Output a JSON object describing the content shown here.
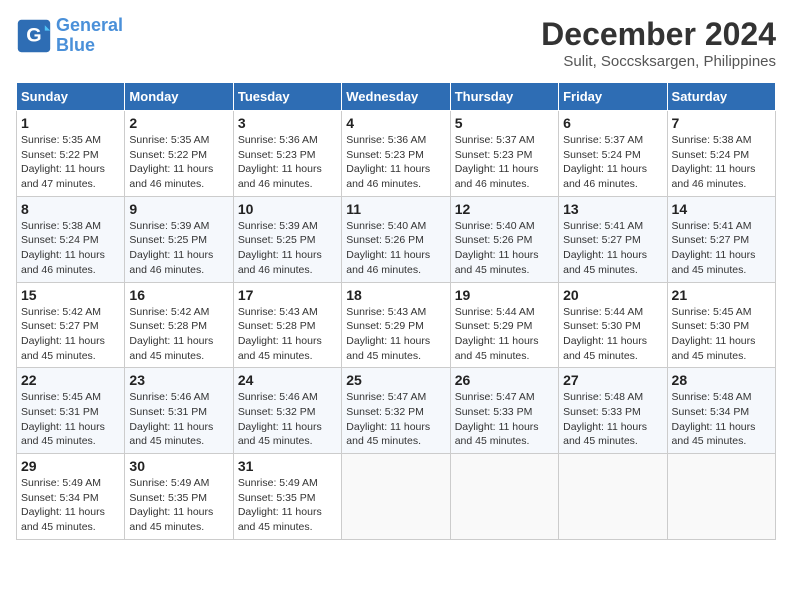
{
  "logo": {
    "line1": "General",
    "line2": "Blue"
  },
  "title": "December 2024",
  "subtitle": "Sulit, Soccsksargen, Philippines",
  "days_of_week": [
    "Sunday",
    "Monday",
    "Tuesday",
    "Wednesday",
    "Thursday",
    "Friday",
    "Saturday"
  ],
  "weeks": [
    [
      {
        "day": 1,
        "sunrise": "5:35 AM",
        "sunset": "5:22 PM",
        "daylight": "11 hours and 47 minutes."
      },
      {
        "day": 2,
        "sunrise": "5:35 AM",
        "sunset": "5:22 PM",
        "daylight": "11 hours and 46 minutes."
      },
      {
        "day": 3,
        "sunrise": "5:36 AM",
        "sunset": "5:23 PM",
        "daylight": "11 hours and 46 minutes."
      },
      {
        "day": 4,
        "sunrise": "5:36 AM",
        "sunset": "5:23 PM",
        "daylight": "11 hours and 46 minutes."
      },
      {
        "day": 5,
        "sunrise": "5:37 AM",
        "sunset": "5:23 PM",
        "daylight": "11 hours and 46 minutes."
      },
      {
        "day": 6,
        "sunrise": "5:37 AM",
        "sunset": "5:24 PM",
        "daylight": "11 hours and 46 minutes."
      },
      {
        "day": 7,
        "sunrise": "5:38 AM",
        "sunset": "5:24 PM",
        "daylight": "11 hours and 46 minutes."
      }
    ],
    [
      {
        "day": 8,
        "sunrise": "5:38 AM",
        "sunset": "5:24 PM",
        "daylight": "11 hours and 46 minutes."
      },
      {
        "day": 9,
        "sunrise": "5:39 AM",
        "sunset": "5:25 PM",
        "daylight": "11 hours and 46 minutes."
      },
      {
        "day": 10,
        "sunrise": "5:39 AM",
        "sunset": "5:25 PM",
        "daylight": "11 hours and 46 minutes."
      },
      {
        "day": 11,
        "sunrise": "5:40 AM",
        "sunset": "5:26 PM",
        "daylight": "11 hours and 46 minutes."
      },
      {
        "day": 12,
        "sunrise": "5:40 AM",
        "sunset": "5:26 PM",
        "daylight": "11 hours and 45 minutes."
      },
      {
        "day": 13,
        "sunrise": "5:41 AM",
        "sunset": "5:27 PM",
        "daylight": "11 hours and 45 minutes."
      },
      {
        "day": 14,
        "sunrise": "5:41 AM",
        "sunset": "5:27 PM",
        "daylight": "11 hours and 45 minutes."
      }
    ],
    [
      {
        "day": 15,
        "sunrise": "5:42 AM",
        "sunset": "5:27 PM",
        "daylight": "11 hours and 45 minutes."
      },
      {
        "day": 16,
        "sunrise": "5:42 AM",
        "sunset": "5:28 PM",
        "daylight": "11 hours and 45 minutes."
      },
      {
        "day": 17,
        "sunrise": "5:43 AM",
        "sunset": "5:28 PM",
        "daylight": "11 hours and 45 minutes."
      },
      {
        "day": 18,
        "sunrise": "5:43 AM",
        "sunset": "5:29 PM",
        "daylight": "11 hours and 45 minutes."
      },
      {
        "day": 19,
        "sunrise": "5:44 AM",
        "sunset": "5:29 PM",
        "daylight": "11 hours and 45 minutes."
      },
      {
        "day": 20,
        "sunrise": "5:44 AM",
        "sunset": "5:30 PM",
        "daylight": "11 hours and 45 minutes."
      },
      {
        "day": 21,
        "sunrise": "5:45 AM",
        "sunset": "5:30 PM",
        "daylight": "11 hours and 45 minutes."
      }
    ],
    [
      {
        "day": 22,
        "sunrise": "5:45 AM",
        "sunset": "5:31 PM",
        "daylight": "11 hours and 45 minutes."
      },
      {
        "day": 23,
        "sunrise": "5:46 AM",
        "sunset": "5:31 PM",
        "daylight": "11 hours and 45 minutes."
      },
      {
        "day": 24,
        "sunrise": "5:46 AM",
        "sunset": "5:32 PM",
        "daylight": "11 hours and 45 minutes."
      },
      {
        "day": 25,
        "sunrise": "5:47 AM",
        "sunset": "5:32 PM",
        "daylight": "11 hours and 45 minutes."
      },
      {
        "day": 26,
        "sunrise": "5:47 AM",
        "sunset": "5:33 PM",
        "daylight": "11 hours and 45 minutes."
      },
      {
        "day": 27,
        "sunrise": "5:48 AM",
        "sunset": "5:33 PM",
        "daylight": "11 hours and 45 minutes."
      },
      {
        "day": 28,
        "sunrise": "5:48 AM",
        "sunset": "5:34 PM",
        "daylight": "11 hours and 45 minutes."
      }
    ],
    [
      {
        "day": 29,
        "sunrise": "5:49 AM",
        "sunset": "5:34 PM",
        "daylight": "11 hours and 45 minutes."
      },
      {
        "day": 30,
        "sunrise": "5:49 AM",
        "sunset": "5:35 PM",
        "daylight": "11 hours and 45 minutes."
      },
      {
        "day": 31,
        "sunrise": "5:49 AM",
        "sunset": "5:35 PM",
        "daylight": "11 hours and 45 minutes."
      },
      null,
      null,
      null,
      null
    ]
  ]
}
